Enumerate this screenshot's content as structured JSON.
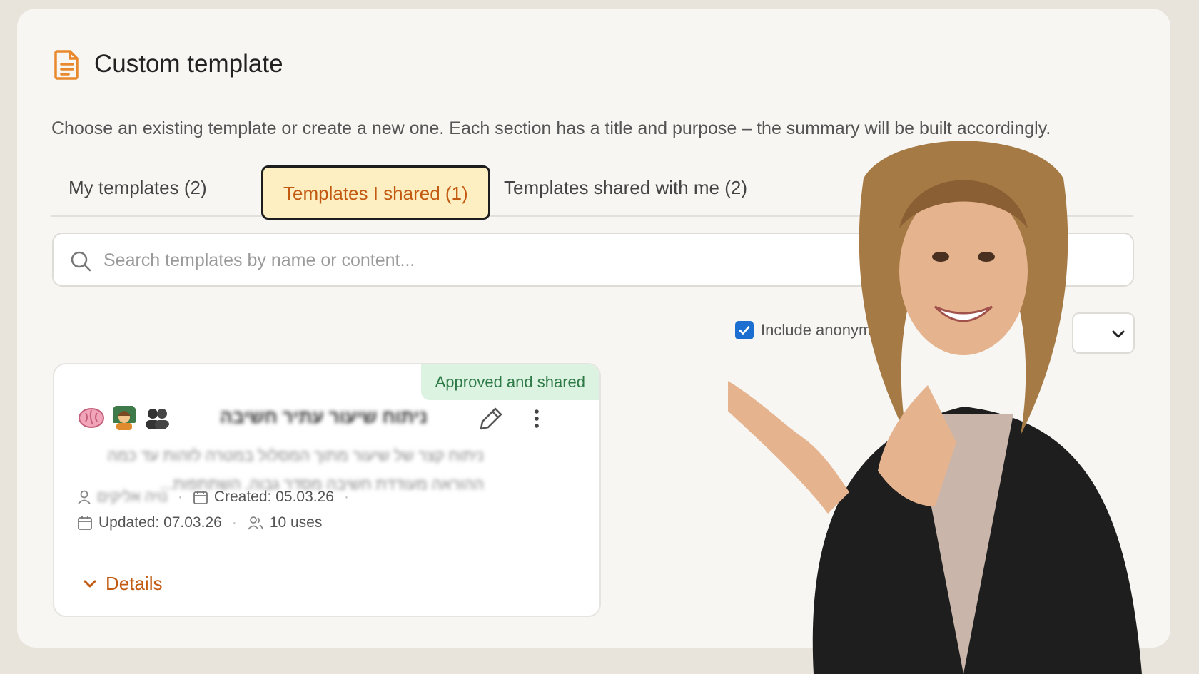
{
  "header": {
    "title": "Custom template",
    "icon": "document-icon"
  },
  "description": "Choose an existing template or create a new one. Each section has a title and purpose – the summary will be built accordingly.",
  "tabs": [
    {
      "label": "My templates (2)",
      "active": false
    },
    {
      "label": "Templates I shared (1)",
      "active": true
    },
    {
      "label": "Templates shared with me (2)",
      "active": false
    }
  ],
  "search": {
    "placeholder": "Search templates by name or content..."
  },
  "filters": {
    "include_anonymous_label": "Include anonymous",
    "include_anonymous_checked": true
  },
  "card": {
    "badge": "Approved and shared",
    "title": "ניתוח שיעור עתיר חשיבה",
    "description": "ניתוח קצר של שיעור מתוך המסלול במטרה לזהות עד כמה ההוראה מעודדת חשיבה מסדר גבוה, השתתפות...",
    "author": "נויה אליקים",
    "created": "Created: 05.03.26",
    "updated": "Updated: 07.03.26",
    "uses": "10 uses",
    "details_label": "Details"
  },
  "colors": {
    "accent": "#c25a12",
    "active_tab_bg": "#fdefc2",
    "badge_bg": "#dcf3e2",
    "checkbox": "#1c6fd1"
  }
}
